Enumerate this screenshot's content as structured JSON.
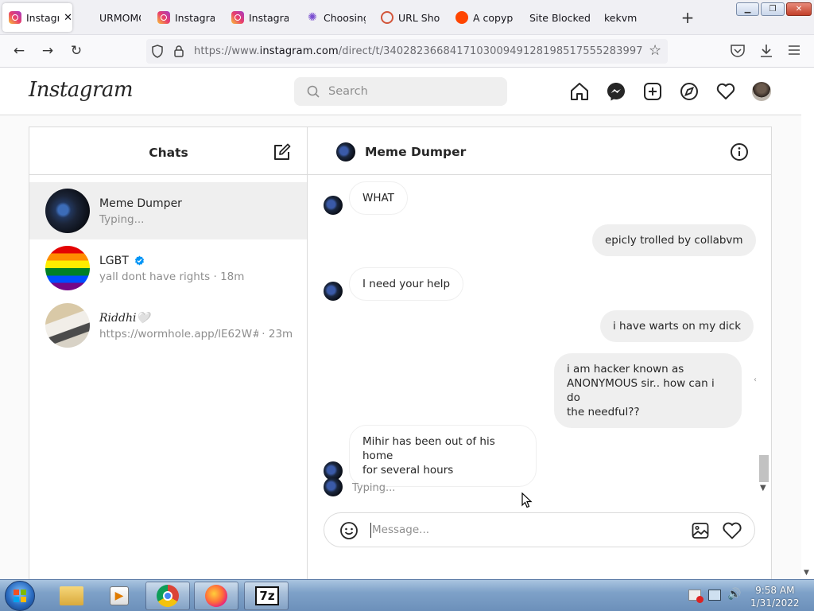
{
  "browser": {
    "tabs": [
      {
        "label": "Instagr",
        "favicon": "instagram-icon",
        "active": true
      },
      {
        "label": "URMOMC",
        "favicon": "none"
      },
      {
        "label": "Instagram",
        "favicon": "instagram-icon"
      },
      {
        "label": "Instagram",
        "favicon": "instagram-icon"
      },
      {
        "label": "Choosing",
        "favicon": "star-icon"
      },
      {
        "label": "URL Short",
        "favicon": "link-icon"
      },
      {
        "label": "A copypa",
        "favicon": "reddit-icon"
      },
      {
        "label": "Site Blocked",
        "favicon": "none"
      },
      {
        "label": "kekvm",
        "favicon": "none"
      }
    ],
    "url_prefix": "https://www.",
    "url_host": "instagram.com",
    "url_path": "/direct/t/340282366841710300949128198517555283997"
  },
  "instagram": {
    "logo": "Instagram",
    "search_placeholder": "Search",
    "chats_title": "Chats",
    "chats": [
      {
        "name": "Meme Dumper",
        "sub": "Typing...",
        "time": "",
        "selected": true
      },
      {
        "name": "LGBT",
        "verified": true,
        "sub": "yall dont have rights",
        "time": "· 18m"
      },
      {
        "name": "𝑅𝑖𝑑𝑑ℎ𝑖🤍",
        "sub": "https://wormhole.app/lE62W#...",
        "time": "· 23m"
      }
    ],
    "thread": {
      "title": "Meme Dumper",
      "messages": [
        {
          "from": "them",
          "text": "WHAT"
        },
        {
          "from": "me",
          "text": "epicly trolled by collabvm"
        },
        {
          "from": "them",
          "text": "I need your help"
        },
        {
          "from": "me",
          "text": "i have warts on my dick"
        },
        {
          "from": "me",
          "lines": [
            "i am hacker known as",
            "ANONYMOUS sir.. how can i do",
            "the needful??"
          ]
        },
        {
          "from": "them",
          "lines": [
            "Mihir has been out of his home",
            "for several hours"
          ]
        }
      ],
      "typing": "Typing...",
      "compose_placeholder": "Message..."
    }
  },
  "taskbar": {
    "time": "9:58 AM",
    "date": "1/31/2022",
    "apps": [
      "windows-explorer-icon",
      "media-player-icon",
      "chrome-icon",
      "firefox-icon",
      "7zip-icon"
    ],
    "sevenzip_label": "7z"
  },
  "colors": {
    "accent_blue": "#0095f6",
    "border": "#dbdbdb",
    "text": "#262626",
    "muted": "#8e8e8e"
  }
}
